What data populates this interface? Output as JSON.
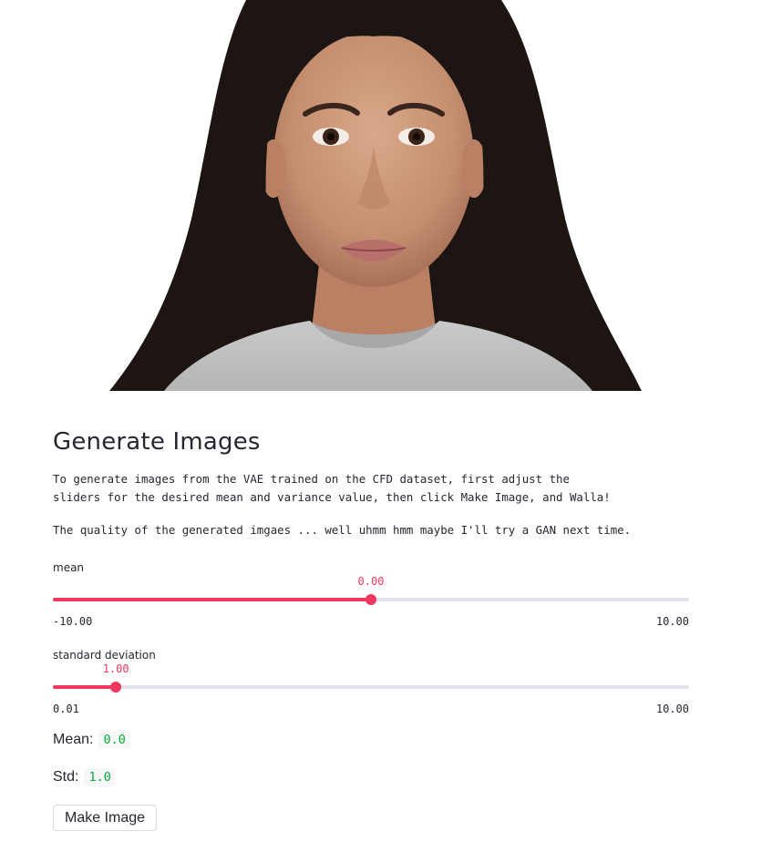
{
  "app": {
    "image_alt": "portrait-photo"
  },
  "header": {
    "title": "Generate Images"
  },
  "description": {
    "line1": "To generate images from the VAE trained on the CFD dataset, first adjust the",
    "line2": "sliders for the desired mean and variance value, then click Make Image, and Walla!",
    "note": "The quality of the generated imgaes ... well uhmm hmm maybe I'll try a GAN next time."
  },
  "sliders": {
    "mean": {
      "label": "mean",
      "value": 0.0,
      "value_text": "0.00",
      "min": -10.0,
      "max": 10.0,
      "min_text": "-10.00",
      "max_text": "10.00"
    },
    "std": {
      "label": "standard deviation",
      "value": 1.0,
      "value_text": "1.00",
      "min": 0.01,
      "max": 10.0,
      "min_text": "0.01",
      "max_text": "10.00"
    }
  },
  "stats": {
    "mean_label": "Mean:",
    "mean_value": "0.0",
    "std_label": "Std:",
    "std_value": "1.0"
  },
  "actions": {
    "make_image_label": "Make Image"
  },
  "colors": {
    "accent": "#f0385e",
    "track": "#e1e4ea",
    "code_text": "#09ab3b",
    "text": "#262730"
  }
}
